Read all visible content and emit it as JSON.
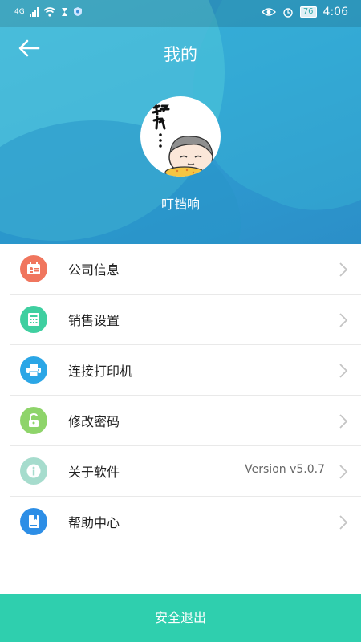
{
  "status_bar": {
    "time": "4:06",
    "battery": "76",
    "network": "4G"
  },
  "header": {
    "title": "我的",
    "username": "叮铛响"
  },
  "menu": [
    {
      "label": "公司信息",
      "icon": "company-card-icon",
      "color": "#f0765e",
      "value": ""
    },
    {
      "label": "销售设置",
      "icon": "calculator-icon",
      "color": "#3fcfa0",
      "value": ""
    },
    {
      "label": "连接打印机",
      "icon": "printer-icon",
      "color": "#2ba6e6",
      "value": ""
    },
    {
      "label": "修改密码",
      "icon": "unlock-icon",
      "color": "#8ed46a",
      "value": ""
    },
    {
      "label": "关于软件",
      "icon": "info-icon",
      "color": "#a6dccd",
      "value": "Version v5.0.7"
    },
    {
      "label": "帮助中心",
      "icon": "help-book-icon",
      "color": "#2d8ee6",
      "value": ""
    }
  ],
  "logout_label": "安全退出"
}
